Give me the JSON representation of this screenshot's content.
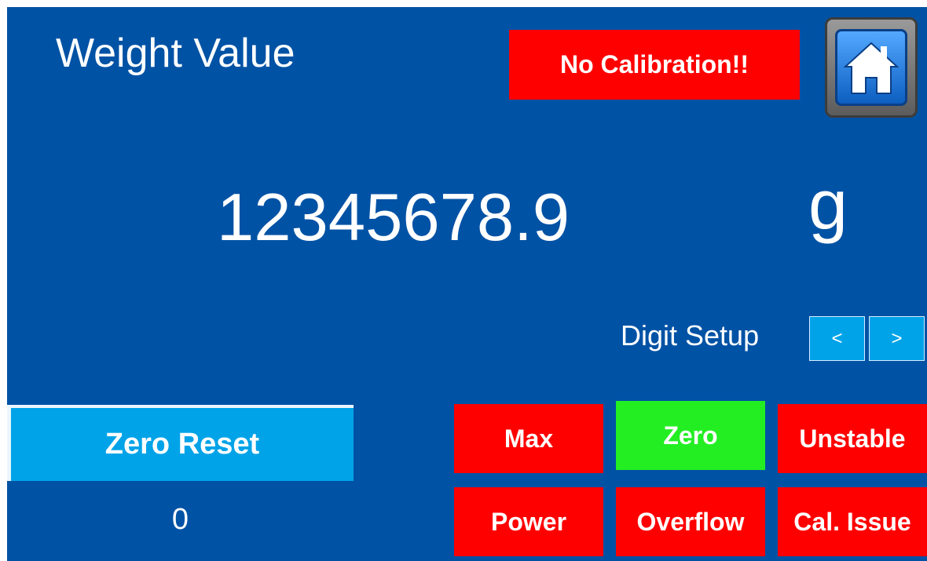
{
  "header": {
    "title": "Weight Value",
    "calibration_warning": "No Calibration!!",
    "home_icon": "home-icon"
  },
  "reading": {
    "value": "12345678.9",
    "unit": "g"
  },
  "digit_setup": {
    "label": "Digit Setup",
    "left_label": "<",
    "right_label": ">"
  },
  "zero_reset": {
    "label": "Zero Reset",
    "value": "0"
  },
  "status": {
    "max": "Max",
    "zero": "Zero",
    "unstable": "Unstable",
    "power": "Power",
    "overflow": "Overflow",
    "cal_issue": "Cal. Issue"
  },
  "colors": {
    "background": "#0052a5",
    "alarm": "#ff0000",
    "ok": "#22ee22",
    "button": "#00a3e8"
  }
}
